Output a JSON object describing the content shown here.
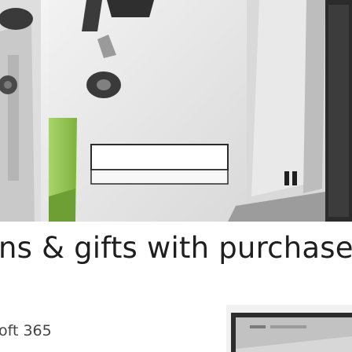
{
  "promo": {
    "headline": "ns & gifts with purchase",
    "offer_label": "oft 365"
  },
  "colors": {
    "text_dark": "#1f1f1f",
    "text_muted": "#444444",
    "photo_background": "#ececec",
    "device_frame": "#2b2b2b"
  }
}
